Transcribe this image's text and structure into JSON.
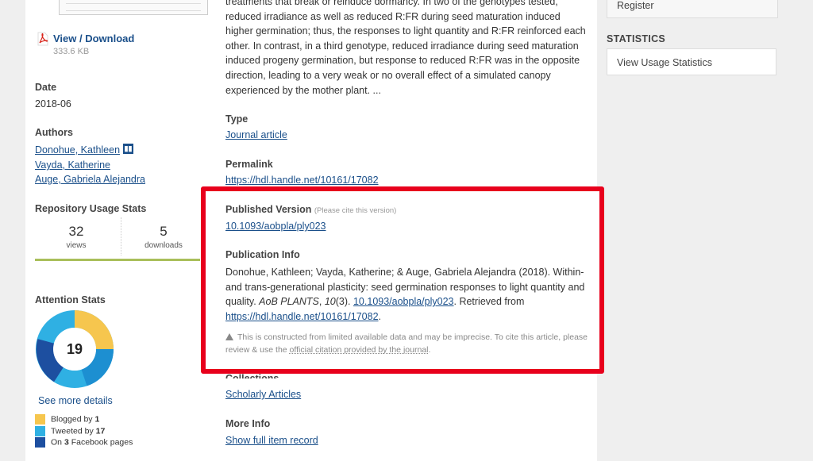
{
  "left": {
    "view_download": "View / Download",
    "file_size": "333.6 KB",
    "date_label": "Date",
    "date_value": "2018-06",
    "authors_label": "Authors",
    "authors": [
      "Donohue, Kathleen",
      "Vayda, Katherine",
      "Auge, Gabriela Alejandra"
    ],
    "usage_label": "Repository Usage Stats",
    "views_count": "32",
    "views_unit": "views",
    "downloads_count": "5",
    "downloads_unit": "downloads",
    "attention_label": "Attention Stats",
    "altmetric_score": "19",
    "see_more": "See more details",
    "legend": [
      {
        "prefix": "Blogged by ",
        "count": "1",
        "suffix": "",
        "color": "#f6c64e"
      },
      {
        "prefix": "Tweeted by ",
        "count": "17",
        "suffix": "",
        "color": "#2fb0e3"
      },
      {
        "prefix": "On ",
        "count": "3",
        "suffix": " Facebook pages",
        "color": "#1d4fa0"
      }
    ]
  },
  "main": {
    "abstract": "treatments that break or reinduce dormancy. In two of the genotypes tested, reduced irradiance as well as reduced R:FR during seed maturation induced higher germination; thus, the responses to light quantity and R:FR reinforced each other. In contrast, in a third genotype, reduced irradiance during seed maturation induced progeny germination, but response to reduced R:FR was in the opposite direction, leading to a very weak or no overall effect of a simulated canopy experienced by the mother plant. ...",
    "type_label": "Type",
    "type_value": "Journal article",
    "permalink_label": "Permalink",
    "permalink_value": "https://hdl.handle.net/10161/17082",
    "published_label": "Published Version",
    "published_note": "(Please cite this version)",
    "published_doi": "10.1093/aobpla/ply023",
    "pubinfo_label": "Publication Info",
    "pubinfo_text": "Donohue, Kathleen; Vayda, Katherine; & Auge, Gabriela Alejandra (2018). Within- and trans-generational plasticity: seed germination responses to light quantity and quality. ",
    "pubinfo_journal": "AoB PLANTS",
    "pubinfo_sep": ", ",
    "pubinfo_volume": "10",
    "pubinfo_issue": "(3). ",
    "pubinfo_doi": "10.1093/aobpla/ply023",
    "pubinfo_retrieved": ". Retrieved from ",
    "pubinfo_handle": "https://hdl.handle.net/10161/17082",
    "pubinfo_end": ".",
    "note_text": "This is constructed from limited available data and may be imprecise. To cite this article, please review & use the ",
    "note_link": "official citation provided by the journal",
    "note_end": ".",
    "collections_label": "Collections",
    "collections_value": "Scholarly Articles",
    "moreinfo_label": "More Info",
    "moreinfo_value": "Show full item record"
  },
  "right": {
    "register": "Register",
    "statistics_title": "STATISTICS",
    "view_usage": "View Usage Statistics"
  }
}
